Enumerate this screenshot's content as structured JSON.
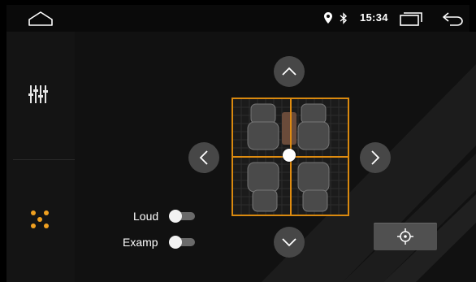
{
  "statusbar": {
    "time": "15:34",
    "icons": [
      "home-icon",
      "location-icon",
      "bluetooth-icon",
      "recent-apps-icon",
      "back-icon"
    ]
  },
  "sidebar": {
    "items": [
      {
        "name": "equalizer",
        "icon": "equalizer-sliders-icon",
        "active": false
      },
      {
        "name": "balance",
        "icon": "balance-dots-icon",
        "active": true
      }
    ]
  },
  "balance": {
    "controls": [
      "arrow-up",
      "arrow-left",
      "arrow-right",
      "arrow-down",
      "center-reset"
    ],
    "position": {
      "fade": 0.5,
      "balance": 0.5
    }
  },
  "toggles": {
    "loud": {
      "label": "Loud",
      "on": false
    },
    "examp": {
      "label": "Examp",
      "on": false
    }
  },
  "colors": {
    "accent": "#e08c10",
    "background": "#111111",
    "sidebar": "#141414",
    "button": "#474747"
  }
}
